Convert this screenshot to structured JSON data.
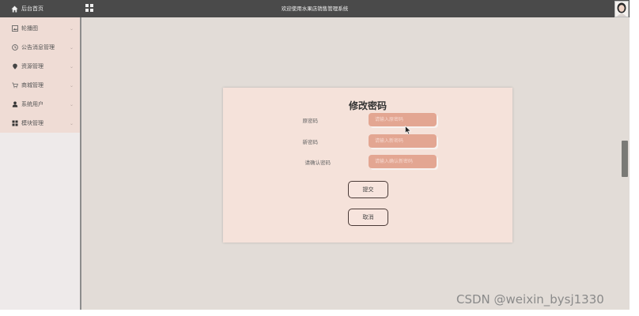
{
  "header": {
    "home_label": "后台首页",
    "title": "欢迎使用水果店销售管理系统"
  },
  "sidebar": {
    "items": [
      {
        "label": "轮播图",
        "icon": "image-icon"
      },
      {
        "label": "公告消息管理",
        "icon": "clock-icon"
      },
      {
        "label": "资源管理",
        "icon": "location-icon"
      },
      {
        "label": "商城管理",
        "icon": "cart-icon"
      },
      {
        "label": "系统用户",
        "icon": "user-icon"
      },
      {
        "label": "模块管理",
        "icon": "grid-icon"
      }
    ],
    "caret": "⌄"
  },
  "form": {
    "title": "修改密码",
    "fields": [
      {
        "label": "原密码",
        "placeholder": "请输入原密码"
      },
      {
        "label": "新密码",
        "placeholder": "请输入新密码"
      },
      {
        "label": "请确认密码",
        "placeholder": "请输入确认新密码"
      }
    ],
    "submit_label": "提交",
    "cancel_label": "取消"
  },
  "watermark": "CSDN @weixin_bysj1330",
  "colors": {
    "topbar": "#4a4a4a",
    "sidebar": "#efdcd5",
    "main_bg": "#e2dcd7",
    "card_bg": "#f5e2da",
    "input_bg": "#e3a692"
  }
}
